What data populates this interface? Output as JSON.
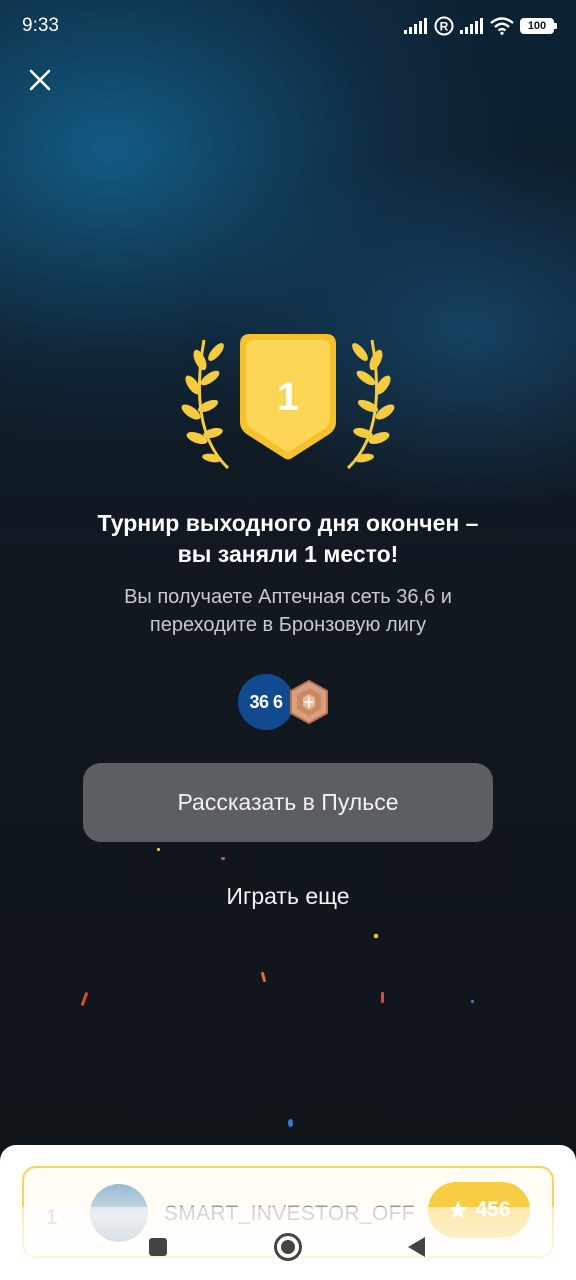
{
  "status_bar": {
    "time": "9:33",
    "battery": "100",
    "icons": [
      "signal-icon",
      "registered-icon",
      "signal-icon",
      "wifi-icon",
      "battery-icon"
    ]
  },
  "close_icon": "close-icon",
  "trophy": {
    "place": "1",
    "colors": {
      "gold": "#f6c12c",
      "gold_light": "#fbd655",
      "laurel": "#f5cc3f"
    }
  },
  "title": {
    "line1": "Турнир выходного дня окончен –",
    "line2": "вы заняли 1 место!"
  },
  "subtitle": {
    "line1": "Вы получаете Аптечная сеть 36,6 и",
    "line2": "переходите в Бронзовую лигу"
  },
  "badges": {
    "brand_label": "36 6",
    "league_icon": "bronze-league-icon"
  },
  "buttons": {
    "share_label": "Рассказать в Пульсе",
    "play_again_label": "Играть еще"
  },
  "leaderboard": {
    "rank": "1",
    "username": "SMART_INVESTOR_OFF",
    "score": "456",
    "score_icon": "star-icon"
  },
  "nav": {
    "icons": [
      "recents-icon",
      "home-icon",
      "back-icon"
    ]
  },
  "colors": {
    "button_bg": "#5b5e62",
    "brand_blue": "#124a8f",
    "bronze": "#c98a63",
    "score_yellow": "#f9cc46"
  }
}
